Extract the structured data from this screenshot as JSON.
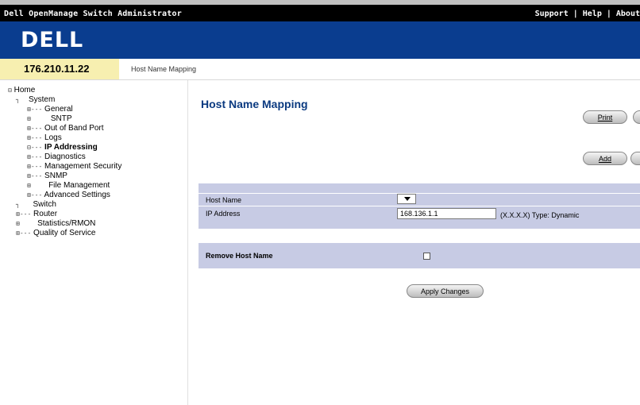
{
  "header": {
    "app_title": "Dell OpenManage Switch Administrator",
    "links": [
      "Support",
      "Help",
      "About"
    ],
    "logo": "DELL"
  },
  "address_bar": {
    "ip": "176.210.11.22",
    "breadcrumb": "Host Name Mapping"
  },
  "sidebar": {
    "items": [
      {
        "prefix": "⊟",
        "label": "Home"
      },
      {
        "prefix": "┐",
        "label": "System"
      },
      {
        "prefix": "⊞---",
        "label": "General"
      },
      {
        "prefix": "⊞",
        "label": "SNTP"
      },
      {
        "prefix": "⊞---",
        "label": "Out of Band Port"
      },
      {
        "prefix": "⊞---",
        "label": "Logs"
      },
      {
        "prefix": "⊟---",
        "label": "IP Addressing"
      },
      {
        "prefix": "⊞---",
        "label": "Diagnostics"
      },
      {
        "prefix": "⊞---",
        "label": "Management Security"
      },
      {
        "prefix": "⊞---",
        "label": "SNMP"
      },
      {
        "prefix": "⊞",
        "label": "File Management"
      },
      {
        "prefix": "⊞---",
        "label": "Advanced Settings"
      },
      {
        "prefix": "┐",
        "label": "Switch"
      },
      {
        "prefix": "⊞---",
        "label": "Router"
      },
      {
        "prefix": "⊞",
        "label": "Statistics/RMON"
      },
      {
        "prefix": "⊞---",
        "label": "Quality of Service"
      }
    ]
  },
  "main": {
    "title": "Host Name Mapping",
    "print_label": "Print",
    "add_label": "Add",
    "host_name_label": "Host Name",
    "ip_address_label": "IP Address",
    "ip_address_value": "168.136.1.1",
    "ip_hint": "(X.X.X.X)  Type: Dynamic",
    "remove_label": "Remove Host Name",
    "apply_label": "Apply Changes"
  },
  "colors": {
    "brand_blue": "#0a3d8f",
    "ip_box": "#f7efb0",
    "panel": "#c7cbe4",
    "title": "#0b3a80"
  }
}
